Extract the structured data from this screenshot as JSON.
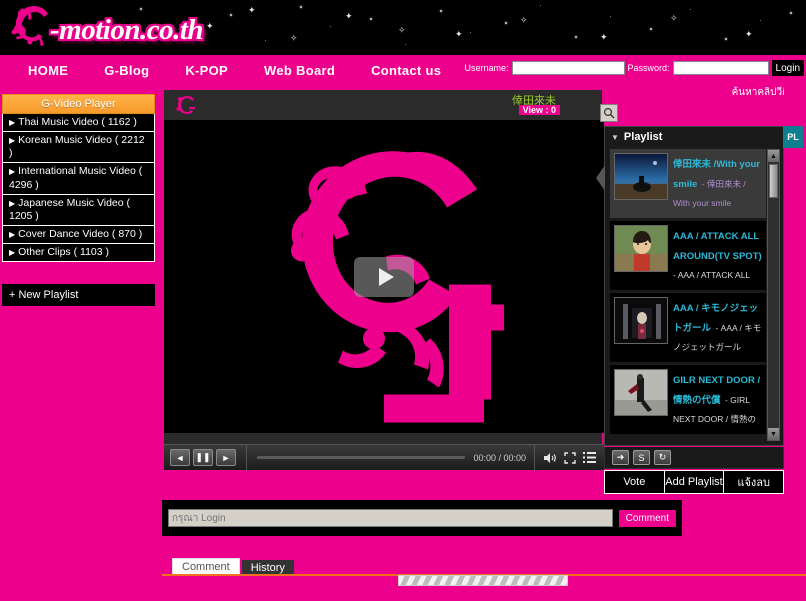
{
  "site": {
    "logo_text": "-motion.co.th",
    "logo_mark": "G"
  },
  "nav": {
    "items": [
      {
        "label": "HOME"
      },
      {
        "label": "G-Blog"
      },
      {
        "label": "K-POP"
      },
      {
        "label": "Web Board"
      },
      {
        "label": "Contact us"
      }
    ]
  },
  "login": {
    "username_label": "Username:",
    "password_label": "Password:",
    "username_value": "",
    "password_value": "",
    "button_label": "Login",
    "search_link": "ค้นหาคลิปวีดีโอ"
  },
  "sidebar": {
    "title": "G-Video Player",
    "items": [
      {
        "label": "Thai Music Video  ( 1162 )"
      },
      {
        "label": "Korean Music Video ( 2212 )"
      },
      {
        "label": "International Music Video ( 4296 )"
      },
      {
        "label": "Japanese Music Video ( 1205 )"
      },
      {
        "label": "Cover Dance Video ( 870 )"
      },
      {
        "label": "Other Clips  ( 1103 )"
      }
    ],
    "new_playlist": "+ New Playlist"
  },
  "player": {
    "video_title": "倖田來未",
    "view_badge": "View : 0",
    "time_display": "00:00 / 00:00",
    "controls": {
      "prev": "◄",
      "pause": "❚❚",
      "next": "►"
    }
  },
  "playlist": {
    "panel_title": "Playlist",
    "tab_label": "PL",
    "items": [
      {
        "title": "倖田來未 /With your smile",
        "desc": "- 倖田來未 / With your smile"
      },
      {
        "title": "AAA / ATTACK ALL AROUND(TV SPOT)",
        "desc": "- AAA / ATTACK ALL"
      },
      {
        "title": "AAA / キモノジェットガール",
        "desc": "- AAA / キモノジェットガール"
      },
      {
        "title": "GILR NEXT DOOR / 情熱の代償",
        "desc": "- GIRL NEXT DOOR / 情熱の代償"
      }
    ]
  },
  "actions": {
    "vote": "Vote",
    "add_playlist": "Add Playlist",
    "report": "แจ้งลบ",
    "small_icons": [
      {
        "glyph": "➜"
      },
      {
        "glyph": "S"
      },
      {
        "glyph": "↻"
      }
    ]
  },
  "comment": {
    "placeholder": "กรุณา Login",
    "value": "",
    "button_label": "Comment"
  },
  "bottom_tabs": {
    "tabs": [
      {
        "label": "Comment",
        "active": true
      },
      {
        "label": "History",
        "active": false
      }
    ]
  },
  "colors": {
    "brand_pink": "#ec008c",
    "accent_orange": "#f79a2c",
    "title_green": "#9acd32",
    "pl_title_blue": "#2bb9d6",
    "pl_desc_purple": "#b08fd0",
    "pl_tab_teal": "#0f7f8f"
  }
}
